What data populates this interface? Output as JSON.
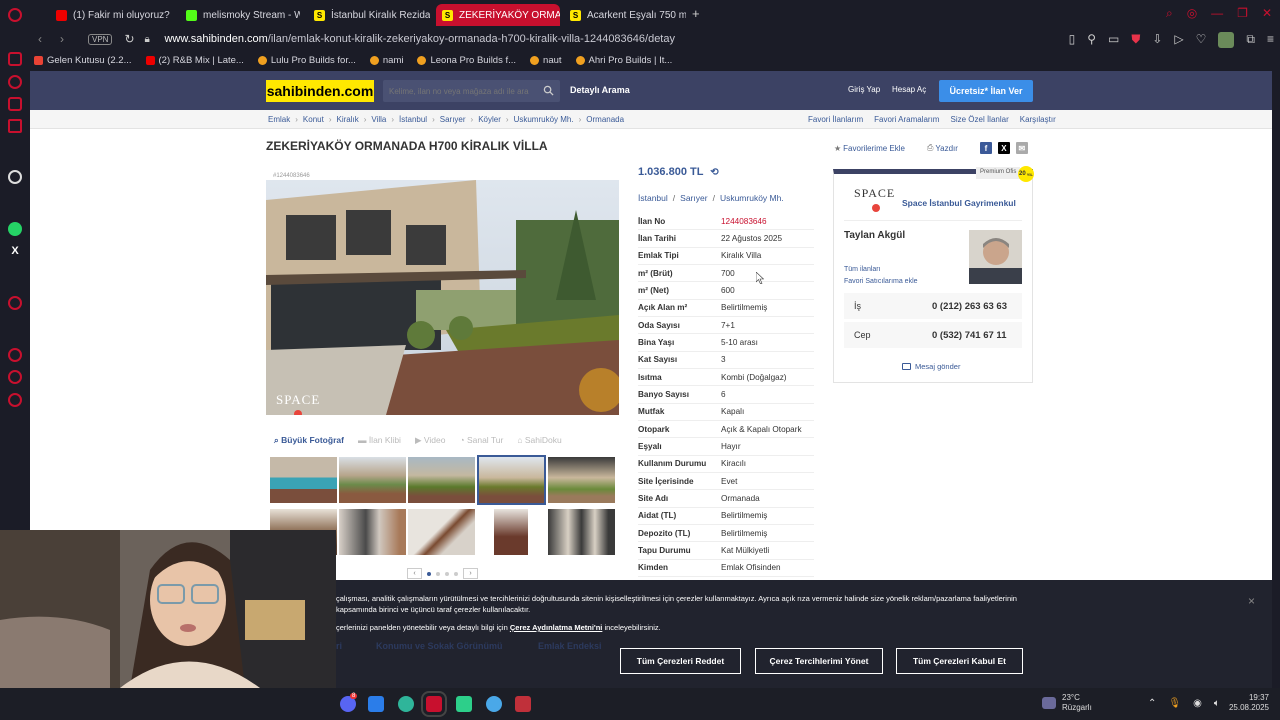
{
  "browser": {
    "tabs": [
      {
        "label": "(1) Fakir mi oluyoruz? dah",
        "fav": "#e00",
        "active": false
      },
      {
        "label": "melismoky Stream - Watc",
        "fav": "#53fc18",
        "active": false
      },
      {
        "label": "İstanbul Kiralık Rezidans",
        "fav": "#ffe800",
        "active": false
      },
      {
        "label": "ZEKERİYAKÖY ORMANAI",
        "fav": "#ffe800",
        "active": true
      },
      {
        "label": "Acarkent Eşyalı 750 m2 B",
        "fav": "#ffe800",
        "active": false
      }
    ],
    "fav_letter": "S",
    "new_tab": "+",
    "vpn": "VPN",
    "url_host": "www.sahibinden.com",
    "url_path": "/ilan/emlak-konut-kiralik-zekeriyakoy-ormanada-h700-kiralik-villa-1244083646/detay",
    "bookmarks": [
      {
        "label": "Gelen Kutusu (2.2...",
        "color": "#ea4335"
      },
      {
        "label": "(2) R&B Mix | Late...",
        "color": "#e00"
      },
      {
        "label": "Lulu Pro Builds for...",
        "color": "#f0a020"
      },
      {
        "label": "nami",
        "color": "#f0a020"
      },
      {
        "label": "Leona Pro Builds f...",
        "color": "#f0a020"
      },
      {
        "label": "naut",
        "color": "#f0a020"
      },
      {
        "label": "Ahri Pro Builds | It...",
        "color": "#f0a020"
      }
    ]
  },
  "site": {
    "logo": "sahibinden.com",
    "search_placeholder": "Kelime, ilan no veya mağaza adı ile ara",
    "detailed_search": "Detaylı Arama",
    "login": "Giriş Yap",
    "register": "Hesap Aç",
    "post_ad": "Ücretsiz* İlan Ver",
    "breadcrumbs": [
      "Emlak",
      "Konut",
      "Kiralık",
      "Villa",
      "İstanbul",
      "Sarıyer",
      "Köyler",
      "Uskumruköy Mh.",
      "Ormanada"
    ],
    "crumb_links": [
      "Favori İlanlarım",
      "Favori Aramalarım",
      "Size Özel İlanlar",
      "Karşılaştır"
    ]
  },
  "listing": {
    "title": "ZEKERİYAKÖY ORMANADA H700 KİRALIK VİLLA",
    "add_favorite": "Favorilerime Ekle",
    "print": "Yazdır",
    "ad_number_tag": "#1244083646",
    "price": "1.036.800 TL",
    "location": [
      "İstanbul",
      "Sarıyer",
      "Uskumruköy Mh."
    ],
    "photo_tabs": [
      "Büyük Fotoğraf",
      "İlan Klibi",
      "Video",
      "Sanal Tur",
      "SahiDoku"
    ],
    "watermark": "SPACE",
    "details": [
      {
        "k": "İlan No",
        "v": "1244083646",
        "red": true
      },
      {
        "k": "İlan Tarihi",
        "v": "22 Ağustos 2025"
      },
      {
        "k": "Emlak Tipi",
        "v": "Kiralık Villa"
      },
      {
        "k": "m² (Brüt)",
        "v": "700"
      },
      {
        "k": "m² (Net)",
        "v": "600"
      },
      {
        "k": "Açık Alan m²",
        "v": "Belirtilmemiş"
      },
      {
        "k": "Oda Sayısı",
        "v": "7+1"
      },
      {
        "k": "Bina Yaşı",
        "v": "5-10 arası"
      },
      {
        "k": "Kat Sayısı",
        "v": "3"
      },
      {
        "k": "Isıtma",
        "v": "Kombi (Doğalgaz)"
      },
      {
        "k": "Banyo Sayısı",
        "v": "6"
      },
      {
        "k": "Mutfak",
        "v": "Kapalı"
      },
      {
        "k": "Otopark",
        "v": "Açık & Kapalı Otopark"
      },
      {
        "k": "Eşyalı",
        "v": "Hayır"
      },
      {
        "k": "Kullanım Durumu",
        "v": "Kiracılı"
      },
      {
        "k": "Site İçerisinde",
        "v": "Evet"
      },
      {
        "k": "Site Adı",
        "v": "Ormanada"
      },
      {
        "k": "Aidat (TL)",
        "v": "Belirtilmemiş"
      },
      {
        "k": "Depozito (TL)",
        "v": "Belirtilmemiş"
      },
      {
        "k": "Tapu Durumu",
        "v": "Kat Mülkiyetli"
      },
      {
        "k": "Kimden",
        "v": "Emlak Ofisinden"
      }
    ]
  },
  "seller": {
    "premium": "Premium Ofis",
    "years": "20",
    "years_unit": "YIL",
    "logo": "SPACE",
    "office": "Space İstanbul Gayrimenkul",
    "agent": "Taylan Akgül",
    "all_ads": "Tüm ilanları",
    "fav_seller": "Favori Satıcılarıma ekle",
    "phone_work_label": "İş",
    "phone_work": "0 (212) 263 63 63",
    "phone_mobile_label": "Cep",
    "phone_mobile": "0 (532) 741 67 11",
    "message": "Mesaj gönder"
  },
  "cookie": {
    "line1": "çalışması, analitik çalışmaların yürütülmesi ve tercihlerinizi doğrultusunda sitenin kişiselleştirilmesi için çerezler kullanmaktayız. Ayrıca açık rıza vermeniz halinde size yönelik reklam/pazarlama faaliyetlerinin",
    "line2": "kapsamında birinci ve üçüncü taraf çerezler kullanılacaktır.",
    "line3_pre": "çerlerinizi panelden yönetebilir veya detaylı bilgi için",
    "line3_link": "Çerez Aydınlatma Metni'ni",
    "line3_post": "inceleyebilirsiniz.",
    "reject": "Tüm Çerezleri Reddet",
    "manage": "Çerez Tercihlerimi Yönet",
    "accept": "Tüm Çerezleri Kabul Et",
    "behind_1": "Konumu ve Sokak Görünümü",
    "behind_2": "Emlak Endeksi",
    "behind_0": "ri",
    "close": "×"
  },
  "taskbar": {
    "badge": "8",
    "temp": "23°C",
    "weather": "Rüzgarlı",
    "time": "19:37",
    "date": "25.08.2025"
  }
}
